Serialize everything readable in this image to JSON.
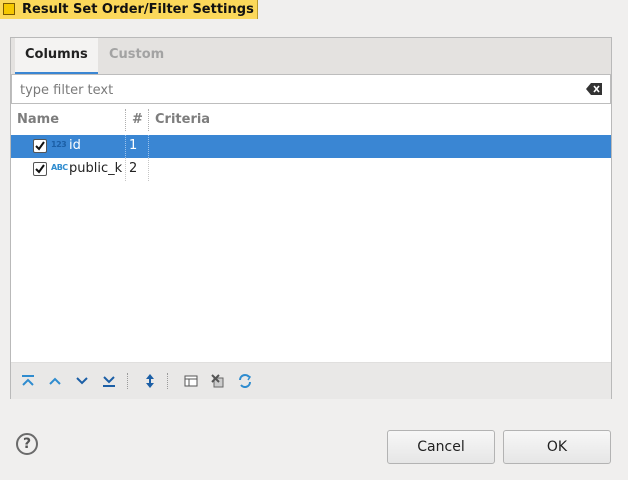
{
  "window": {
    "title": "Result Set Order/Filter Settings"
  },
  "tabs": [
    {
      "label": "Columns",
      "active": true
    },
    {
      "label": "Custom",
      "active": false
    }
  ],
  "filter": {
    "placeholder": "type filter text",
    "value": ""
  },
  "grid": {
    "headers": {
      "name": "Name",
      "num": "#",
      "criteria": "Criteria"
    },
    "rows": [
      {
        "name": "id",
        "num": "1",
        "type_icon": "123",
        "checked": true,
        "selected": true
      },
      {
        "name": "public_k",
        "num": "2",
        "type_icon": "ABC",
        "checked": true,
        "selected": false
      }
    ]
  },
  "toolbar": {
    "icons": [
      "move-top-icon",
      "move-up-icon",
      "move-down-icon",
      "move-bottom-icon",
      "sort-icon",
      "configure-columns-icon",
      "clear-criteria-icon",
      "reset-icon"
    ]
  },
  "buttons": {
    "cancel": "Cancel",
    "ok": "OK",
    "help": "?"
  },
  "colors": {
    "accent": "#3a86d3",
    "title_tab": "#fbd85a",
    "icon_blue": "#2f8ccf"
  }
}
